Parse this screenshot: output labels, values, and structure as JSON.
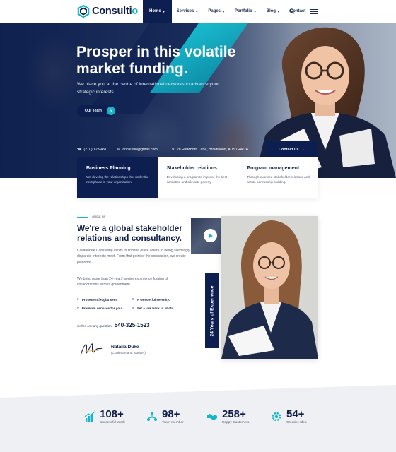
{
  "brand": {
    "name_prefix": "Consulti",
    "name_suffix": "o",
    "accent": "#17b5c8",
    "navy": "#0c1f50"
  },
  "nav": {
    "items": [
      {
        "label": "Home",
        "active": true
      },
      {
        "label": "Services",
        "active": false
      },
      {
        "label": "Pages",
        "active": false
      },
      {
        "label": "Portfolio",
        "active": false
      },
      {
        "label": "Blog",
        "active": false
      },
      {
        "label": "Contact",
        "active": false
      }
    ],
    "icons": [
      "search-icon",
      "menu-icon"
    ]
  },
  "hero": {
    "title": "Prosper in this volatile market funding.",
    "subtitle": "We place you at the centre of international networks to advance your strategic interests",
    "cta_label": "Our Team",
    "phone": "(210) 123-451",
    "email": "consultio@gmail.com",
    "address": "28 Hawthorn Lane, Braidwood, AUSTRALIA",
    "contact_button": "Contact us"
  },
  "services": [
    {
      "title": "Business Planning",
      "text": "We develop the relationships that under the next phase in your organisation."
    },
    {
      "title": "Stakeholder relations",
      "text": "Developing a program to improve the best sanitation and alleviate poverty"
    },
    {
      "title": "Program management",
      "text": "Through nuanced stakeholder relations and astute partnership building."
    }
  ],
  "about": {
    "tag": "About us",
    "title": "We're a global stakeholder relations and consultancy.",
    "p1": "Collaborate Consulting exists to find the place where to being seemingly disparate interests meet. From that point of the connection, we create platforms.",
    "p2": "We bring more than 24 years' senior experience forging of collaborations across government.",
    "features": [
      "Prosesent feugiat sem",
      "A wonderful serenity.",
      "Premium services for you.",
      "Set a link back to photo."
    ],
    "call_prefix": "Call to ask ",
    "call_link": "any question",
    "phone": "540-325-1523",
    "person_name": "Natalia Duke",
    "person_role": "(Chairman and founder)",
    "experience_badge": "24 Years of Experience"
  },
  "stats": [
    {
      "value": "108+",
      "label": "Successful Work",
      "icon": "growth-chart-icon"
    },
    {
      "value": "98+",
      "label": "Team member",
      "icon": "team-network-icon"
    },
    {
      "value": "258+",
      "label": "Happy Customers",
      "icon": "handshake-icon"
    },
    {
      "value": "54+",
      "label": "Creative Idea",
      "icon": "gear-idea-icon"
    }
  ]
}
